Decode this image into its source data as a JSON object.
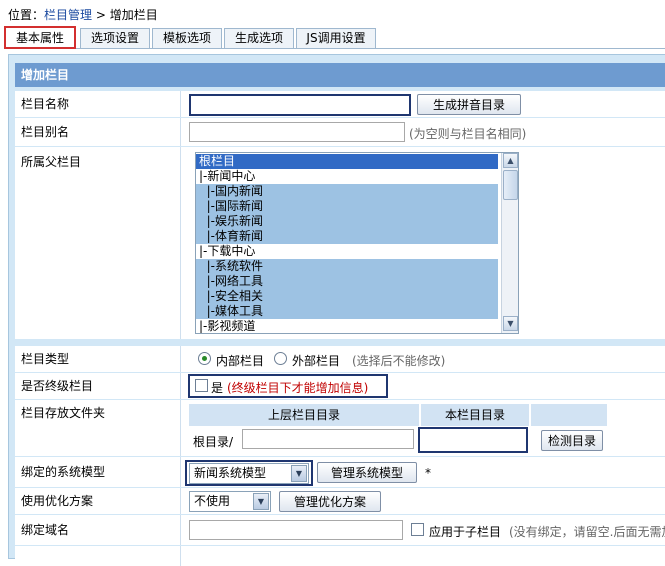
{
  "breadcrumb": {
    "prefix": "位置：",
    "link": "栏目管理",
    "sep": ">",
    "current": "增加栏目"
  },
  "tabs": [
    "基本属性",
    "选项设置",
    "模板选项",
    "生成选项",
    "JS调用设置"
  ],
  "panel_title": "增加栏目",
  "fields": {
    "name": {
      "label": "栏目名称",
      "value": "",
      "button": "生成拼音目录"
    },
    "alias": {
      "label": "栏目别名",
      "value": "",
      "hint": "(为空则与栏目名相同)"
    },
    "parent": {
      "label": "所属父栏目",
      "options": [
        "根栏目",
        "|-新闻中心",
        "  |-国内新闻",
        "  |-国际新闻",
        "  |-娱乐新闻",
        "  |-体育新闻",
        "|-下载中心",
        "  |-系统软件",
        "  |-网络工具",
        "  |-安全相关",
        "  |-媒体工具",
        "|-影视频道"
      ]
    },
    "type": {
      "label": "栏目类型",
      "opt_internal": "内部栏目",
      "opt_external": "外部栏目",
      "note": "(选择后不能修改)"
    },
    "final": {
      "label": "是否终级栏目",
      "checkbox": "是",
      "note": "(终级栏目下才能增加信息)"
    },
    "folder": {
      "label": "栏目存放文件夹",
      "col_upper": "上层栏目目录",
      "col_this": "本栏目目录",
      "root": "根目录/",
      "upper_value": "",
      "this_value": "",
      "button": "检测目录"
    },
    "model": {
      "label": "绑定的系统模型",
      "selected": "新闻系统模型",
      "button": "管理系统模型",
      "required": "*"
    },
    "optimize": {
      "label": "使用优化方案",
      "selected": "不使用",
      "button": "管理优化方案"
    },
    "domain": {
      "label": "绑定域名",
      "value": "",
      "checkbox": "应用于子栏目",
      "note": "(没有绑定，请留空.后面无需加"
    }
  }
}
